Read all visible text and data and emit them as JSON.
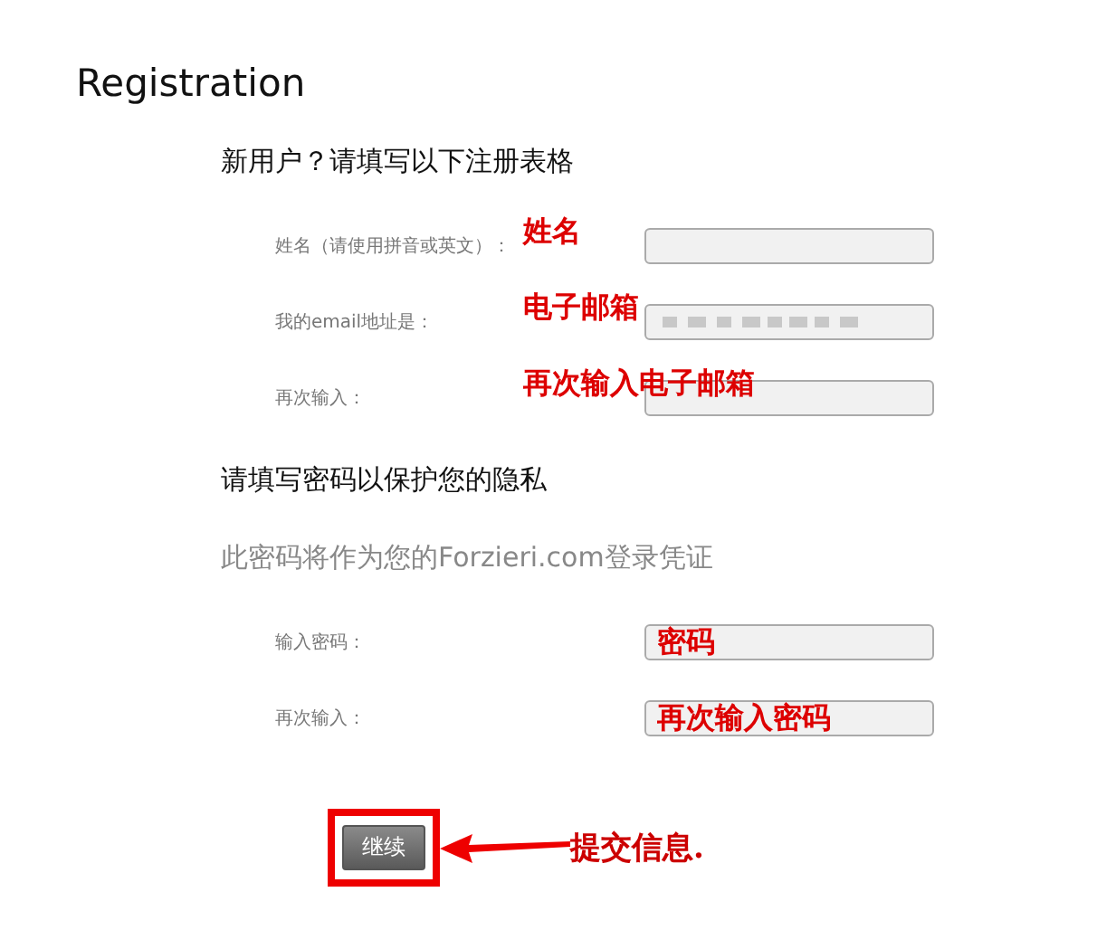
{
  "title": "Registration",
  "section_1": {
    "heading": "新用户？请填写以下注册表格",
    "fields": [
      {
        "label": "姓名（请使用拼音或英文）：",
        "annotation": {
          "kind": "beside",
          "text": "姓名"
        }
      },
      {
        "label": "我的email地址是：",
        "redacted": true,
        "annotation": {
          "kind": "beside",
          "text": "电子邮箱"
        }
      },
      {
        "label": "再次输入：",
        "annotation": {
          "kind": "beside",
          "text": "再次输入电子邮箱"
        }
      }
    ]
  },
  "section_2": {
    "heading": "请填写密码以保护您的隐私",
    "note": "此密码将作为您的Forzieri.com登录凭证",
    "fields": [
      {
        "label": "输入密码：",
        "annotation": {
          "kind": "inside",
          "text": "密码"
        }
      },
      {
        "label": "再次输入：",
        "annotation": {
          "kind": "inside",
          "text": "再次输入密码"
        }
      }
    ]
  },
  "submit": {
    "label": "继续",
    "annotation": "提交信息."
  }
}
